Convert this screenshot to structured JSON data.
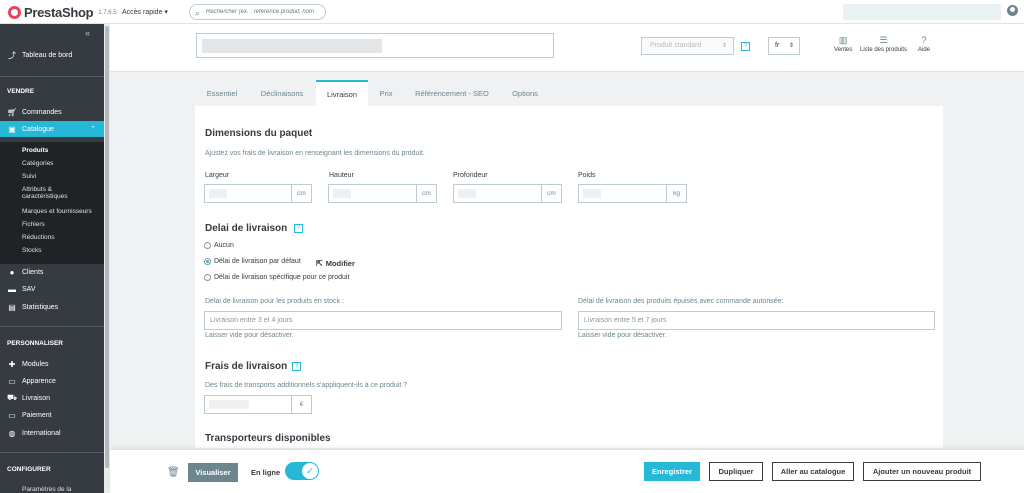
{
  "topbar": {
    "brand": "PrestaShop",
    "version": "1.7.6.5",
    "quick_access": "Accès rapide",
    "quick_caret": "▾",
    "search_placeholder": "Rechercher (ex. : référence produit, nom"
  },
  "sidebar": {
    "collapse": "«",
    "dashboard": "Tableau de bord",
    "section_sell": "VENDRE",
    "orders": "Commandes",
    "catalog": "Catalogue",
    "catalog_sub": [
      "Produits",
      "Catégories",
      "Suivi",
      "Attributs & caractéristiques",
      "Marques et fournisseurs",
      "Fichiers",
      "Réductions",
      "Stocks"
    ],
    "customers": "Clients",
    "sav": "SAV",
    "stats": "Statistiques",
    "section_custom": "PERSONNALISER",
    "modules": "Modules",
    "appearance": "Apparence",
    "shipping": "Livraison",
    "payment": "Paiement",
    "international": "International",
    "section_config": "CONFIGURER",
    "shop_params": "Paramètres de la"
  },
  "header": {
    "product_type": "Produit standard",
    "type_caret": "⇕",
    "help": "?",
    "language": "fr",
    "lang_caret": "⇕",
    "sales": "Ventes",
    "product_list": "Liste des produits",
    "help_label": "Aide"
  },
  "tabs": [
    "Essentiel",
    "Déclinaisons",
    "Livraison",
    "Prix",
    "Référencement - SEO",
    "Options"
  ],
  "form": {
    "dimensions_title": "Dimensions du paquet",
    "dimensions_desc": "Ajustez vos frais de livraison en renseignant les dimensions du produit.",
    "width_label": "Largeur",
    "height_label": "Hauteur",
    "depth_label": "Profondeur",
    "weight_label": "Poids",
    "unit_cm": "cm",
    "unit_kg": "kg",
    "delay_title": "Delai de livraison",
    "delay_help": "?",
    "delay_none": "Aucun",
    "delay_default": "Délai de livraison par défaut",
    "modify": "Modifier",
    "delay_specific": "Délai de livraison spécifique pour ce produit",
    "in_stock_label": "Délai de livraison pour les produits en stock :",
    "in_stock_placeholder": "Livraison entre 3 et 4 jours",
    "in_stock_help": "Laisser vide pour désactiver.",
    "out_stock_label": "Délai de livraison des produits épuisés avec commande autorisée:",
    "out_stock_placeholder": "Livraison entre 5 et 7 jours",
    "out_stock_help": "Laisser vide pour désactiver.",
    "fees_title": "Frais de livraison",
    "fees_help": "?",
    "fees_desc": "Des frais de transports additionnels s'appliquent-ils à ce produit ?",
    "currency": "€",
    "carriers_title": "Transporteurs disponibles"
  },
  "footer": {
    "preview": "Visualiser",
    "online": "En ligne",
    "online_check": "✓",
    "save": "Enregistrer",
    "duplicate": "Dupliquer",
    "go_catalog": "Aller au catalogue",
    "add_new": "Ajouter un nouveau produit"
  }
}
